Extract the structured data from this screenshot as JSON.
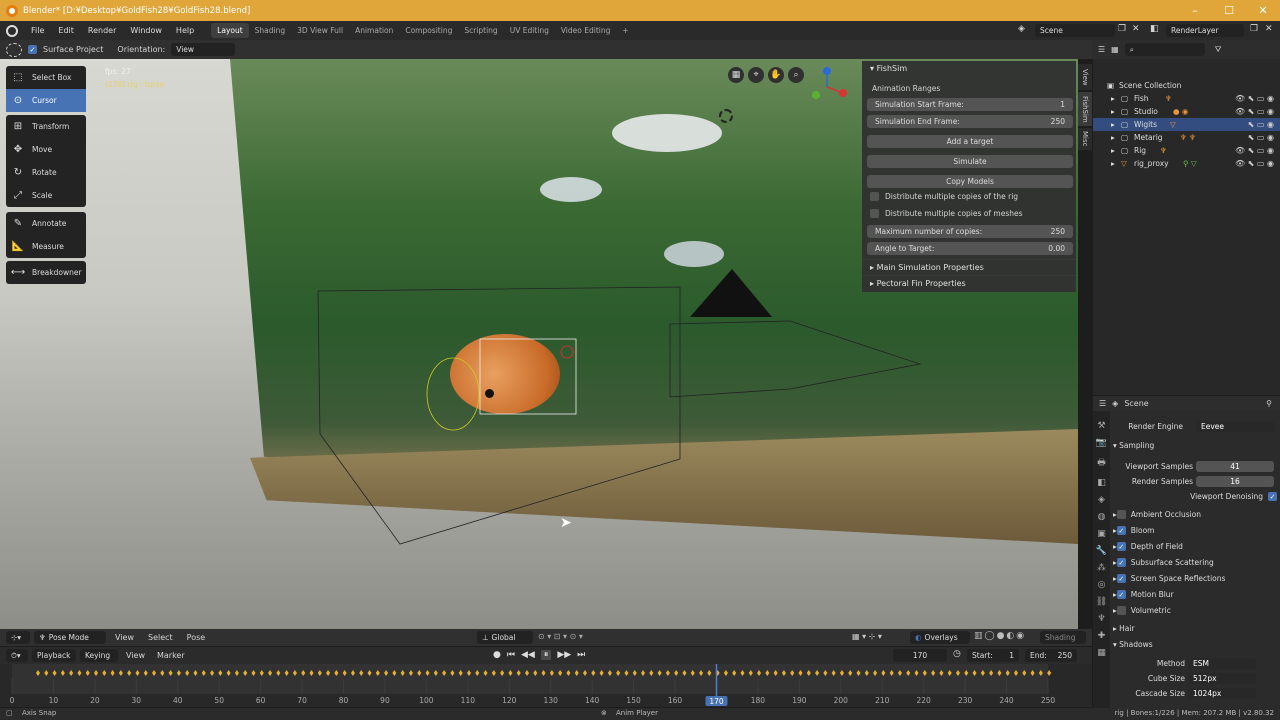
{
  "window": {
    "title": "Blender* [D:¥Desktop¥GoldFish28¥GoldFish28.blend]"
  },
  "menu": {
    "items": [
      "File",
      "Edit",
      "Render",
      "Window",
      "Help"
    ],
    "workspaces": [
      "Layout",
      "Shading",
      "3D View Full",
      "Animation",
      "Compositing",
      "Scripting",
      "UV Editing",
      "Video Editing"
    ],
    "scene": "Scene",
    "render_layer": "RenderLayer"
  },
  "header": {
    "surface_project": "Surface Project",
    "orientation_label": "Orientation:",
    "orientation_value": "View"
  },
  "overlay": {
    "fps": "fps: 27",
    "active": "(170) rig : torso"
  },
  "toolbar": [
    "Select Box",
    "Cursor",
    "Transform",
    "Move",
    "Rotate",
    "Scale",
    "Annotate",
    "Measure",
    "Breakdowner"
  ],
  "npanel": {
    "title": "FishSim",
    "section": "Animation Ranges",
    "start_label": "Simulation Start Frame:",
    "start_value": "1",
    "end_label": "Simulation End Frame:",
    "end_value": "250",
    "add_target": "Add a target",
    "simulate": "Simulate",
    "copy_models": "Copy Models",
    "dist_rig": "Distribute multiple copies of the rig",
    "dist_meshes": "Distribute multiple copies of meshes",
    "max_label": "Maximum number of copies:",
    "max_value": "250",
    "angle_label": "Angle to Target:",
    "angle_value": "0.00",
    "main_props": "Main Simulation Properties",
    "pectoral": "Pectoral Fin Properties",
    "tabs": [
      "View",
      "FishSim",
      "Misc"
    ]
  },
  "outliner": {
    "root": "Scene Collection",
    "items": [
      "Fish",
      "Studio",
      "Wigits",
      "Metarig",
      "Rig",
      "rig_proxy"
    ]
  },
  "properties": {
    "context": "Scene",
    "engine_label": "Render Engine",
    "engine_value": "Eevee",
    "sampling": "Sampling",
    "viewport_samples_label": "Viewport Samples",
    "viewport_samples": "41",
    "render_samples_label": "Render Samples",
    "render_samples": "16",
    "denoise": "Viewport Denoising",
    "effects": [
      {
        "label": "Ambient Occlusion",
        "on": false
      },
      {
        "label": "Bloom",
        "on": true
      },
      {
        "label": "Depth of Field",
        "on": true
      },
      {
        "label": "Subsurface Scattering",
        "on": true
      },
      {
        "label": "Screen Space Reflections",
        "on": true
      },
      {
        "label": "Motion Blur",
        "on": true
      },
      {
        "label": "Volumetric",
        "on": false
      }
    ],
    "hair": "Hair",
    "shadows": "Shadows",
    "method_label": "Method",
    "method_value": "ESM",
    "cube_label": "Cube Size",
    "cube_value": "512px",
    "cascade_label": "Cascade Size",
    "cascade_value": "1024px"
  },
  "viewport_footer": {
    "mode": "Pose Mode",
    "view": "View",
    "select": "Select",
    "pose": "Pose",
    "transform": "Global",
    "overlays": "Overlays",
    "shading": "Shading"
  },
  "timeline": {
    "playback": "Playback",
    "keying": "Keying",
    "view": "View",
    "marker": "Marker",
    "current": "170",
    "start_label": "Start:",
    "start": "1",
    "end_label": "End:",
    "end": "250",
    "ticks": [
      "0",
      "10",
      "20",
      "30",
      "40",
      "50",
      "60",
      "70",
      "80",
      "90",
      "100",
      "110",
      "120",
      "130",
      "140",
      "150",
      "160",
      "170",
      "180",
      "190",
      "200",
      "210",
      "220",
      "230",
      "240",
      "250"
    ],
    "playhead_frame": 170,
    "range_max": 250
  },
  "status": {
    "left": "Axis Snap",
    "center": "Anim Player",
    "right": "rig | Bones:1/226 | Mem: 207.2 MB | v2.80.32"
  }
}
